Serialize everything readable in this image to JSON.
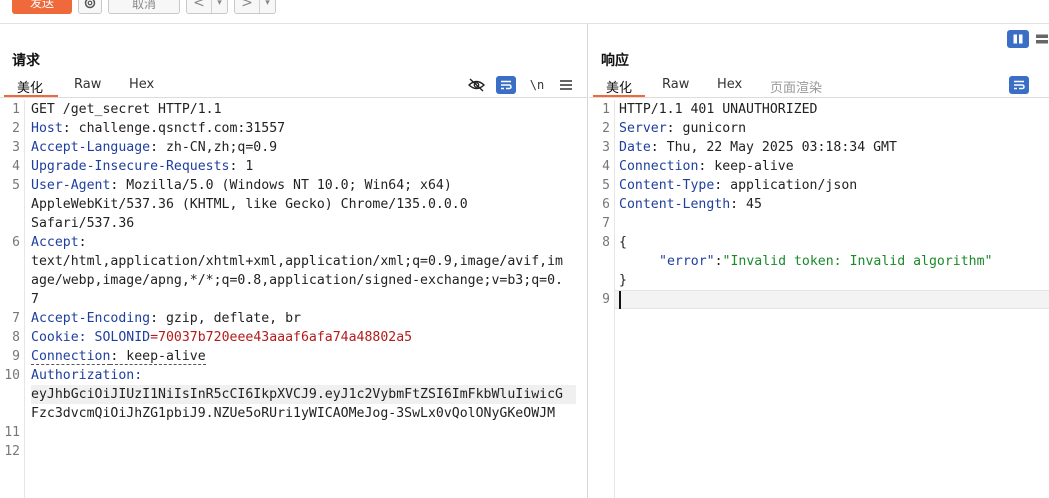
{
  "toolbar": {
    "send_label": "发送",
    "cancel_label": "取消",
    "back_label": "<",
    "forward_label": ">",
    "caret": "▾"
  },
  "request": {
    "title": "请求",
    "tabs": [
      "美化",
      "Raw",
      "Hex"
    ],
    "newline_toggle": "\\n",
    "line_numbers": [
      "1",
      "2",
      "3",
      "4",
      "5",
      "6",
      "7",
      "8",
      "9",
      "10",
      "11",
      "12"
    ],
    "lines": {
      "l1": "GET /get_secret HTTP/1.1",
      "l2_key": "Host",
      "l2_val": ": challenge.qsnctf.com:31557",
      "l3_key": "Accept-Language",
      "l3_val": ": zh-CN,zh;q=0.9",
      "l4_key": "Upgrade-Insecure-Requests",
      "l4_val": ": 1",
      "l5_key": "User-Agent",
      "l5_val": ": Mozilla/5.0 (Windows NT 10.0; Win64; x64)",
      "l5_cont1": "AppleWebKit/537.36 (KHTML, like Gecko) Chrome/135.0.0.0",
      "l5_cont2": "Safari/537.36",
      "l6_key": "Accept",
      "l6_val": ":",
      "l6_cont1": "text/html,application/xhtml+xml,application/xml;q=0.9,image/avif,im",
      "l6_cont2": "age/webp,image/apng,*/*;q=0.8,application/signed-exchange;v=b3;q=0.",
      "l6_cont3": "7",
      "l7_key": "Accept-Encoding",
      "l7_val": ": gzip, deflate, br",
      "l8_key": "Cookie",
      "l8_mid": ": SOLONID",
      "l8_val": "=70037b720eee43aaaf6afa74a48802a5",
      "l9_key": "Connection",
      "l9_val": ": keep-alive",
      "l10_key": "Authorization",
      "l10_val": ":",
      "l10_cont1": "eyJhbGciOiJIUzI1NiIsInR5cCI6IkpXVCJ9.eyJ1c2VybmFtZSI6ImFkbWluIiwicG",
      "l10_cont2": "Fzc3dvcmQiOiJhZG1pbiJ9.NZUe5oRUri1yWICAOMeJog-3SwLx0vQolONyGKeOWJM"
    }
  },
  "response": {
    "title": "响应",
    "tabs": [
      "美化",
      "Raw",
      "Hex",
      "页面渲染"
    ],
    "line_numbers": [
      "1",
      "2",
      "3",
      "4",
      "5",
      "6",
      "7",
      "8",
      "9"
    ],
    "lines": {
      "l1": "HTTP/1.1 401 UNAUTHORIZED",
      "l2_key": "Server",
      "l2_val": ": gunicorn",
      "l3_key": "Date",
      "l3_val": ": Thu, 22 May 2025 03:18:34 GMT",
      "l4_key": "Connection",
      "l4_val": ": keep-alive",
      "l5_key": "Content-Type",
      "l5_val": ": application/json",
      "l6_key": "Content-Length",
      "l6_val": ": 45",
      "l8": "{",
      "json_key": "\"error\"",
      "json_colon": ":",
      "json_val": "\"Invalid token: Invalid algorithm\"",
      "l8_close": "}"
    }
  },
  "colors": {
    "accent": "#f0693b",
    "tool_blue": "#3b6fc6"
  },
  "icons": [
    "gear-icon",
    "eye-off-icon",
    "wrap-icon",
    "menu-icon",
    "layout-columns-icon",
    "layout-rows-icon"
  ]
}
